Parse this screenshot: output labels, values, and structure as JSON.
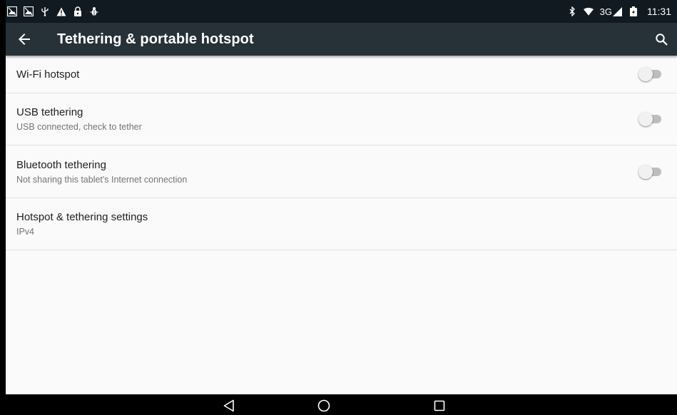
{
  "status_bar": {
    "left_icons": [
      "notification-image-icon",
      "notification-image-icon",
      "usb-icon",
      "warning-icon",
      "lock-icon",
      "bug-icon"
    ],
    "right_icons": [
      "bluetooth-icon",
      "wifi-icon",
      "signal-icon",
      "battery-charging-icon"
    ],
    "network": "3G",
    "time": "11:31"
  },
  "app_bar": {
    "title": "Tethering & portable hotspot",
    "back_icon": "arrow-back-icon",
    "search_icon": "search-icon",
    "background_color": "#263238"
  },
  "settings": [
    {
      "title": "Wi-Fi hotspot",
      "subtitle": "",
      "toggle": false
    },
    {
      "title": "USB tethering",
      "subtitle": "USB connected, check to tether",
      "toggle": false
    },
    {
      "title": "Bluetooth tethering",
      "subtitle": "Not sharing this tablet's Internet connection",
      "toggle": false
    },
    {
      "title": "Hotspot & tethering settings",
      "subtitle": "IPv4"
    }
  ],
  "nav_bar": {
    "buttons": [
      "back-triangle-icon",
      "home-circle-icon",
      "recents-square-icon"
    ]
  }
}
